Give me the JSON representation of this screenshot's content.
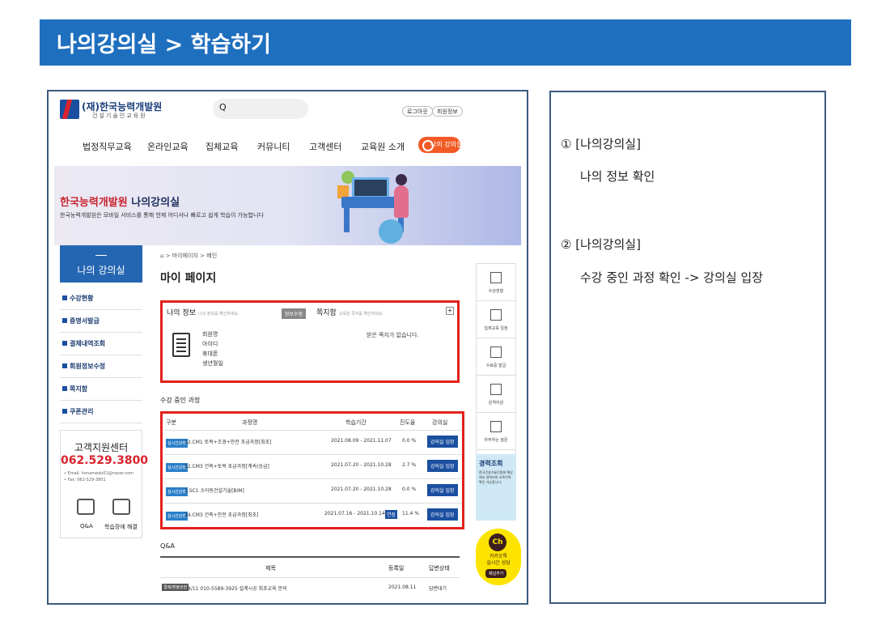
{
  "slide_title": "나의강의실 > 학습하기",
  "site": {
    "logo_text": "(재)한국능력개발원",
    "logo_sub": "건설기술인교육원",
    "search_icon": "Q",
    "header_links": [
      "로그아웃",
      "회원정보"
    ],
    "menu": [
      "법정직무교육",
      "온라인교육",
      "집체교육",
      "커뮤니티",
      "고객센터",
      "교육원 소개"
    ],
    "myroom_button": "나의 강의실"
  },
  "hero": {
    "title_red": "한국능력개발원",
    "title_dark": "나의강의실",
    "subtitle": "한국능력개발원은 모바일 서비스를 통해 언제 어디서나 빠르고 쉽게 학습이 가능합니다"
  },
  "sidebar": {
    "title": "나의 강의실",
    "items": [
      "수강현황",
      "증명서발급",
      "결제내역조회",
      "회원정보수정",
      "쪽지함",
      "쿠폰관리"
    ]
  },
  "support": {
    "title": "고객지원센터",
    "phone": "062.529.3800",
    "email": "• Email: honamedu01@naver.com",
    "fax": "• Fax: 062-529-3801",
    "qa_label": "Q&A",
    "remote_label": "학습장애 해결"
  },
  "breadcrumb": "⌂ > 마이페이지 > 메인",
  "page_title": "마이 페이지",
  "my_info": {
    "header": "나의 정보",
    "header_hint": "나의 정보를 확인하세요.",
    "edit_button": "정보수정",
    "rows": [
      "회원명",
      "아이디",
      "휴대폰",
      "생년월일"
    ]
  },
  "messages": {
    "header": "쪽지함",
    "header_hint": "교육원 쪽지를 확인하세요.",
    "plus": "+",
    "empty": "받은 쪽지가 없습니다."
  },
  "courses": {
    "section_title": "수강 중인 과정",
    "headers": [
      "구분",
      "과정명",
      "학습기간",
      "진도율",
      "강의실"
    ],
    "rows": [
      {
        "badge": "실시간강좌",
        "name": "12.CM1 토목+조경+안전 초급과정[최초]",
        "period": "2021.08.09 - 2021.11.07",
        "progress": "0.0 %",
        "button": "강의실 입장",
        "extend": ""
      },
      {
        "badge": "실시간강좌",
        "name": "52.CM3 건축+토목 초급과정[계속(승급]",
        "period": "2021.07.20 - 2021.10.28",
        "progress": "2.7 %",
        "button": "강의실 입장",
        "extend": ""
      },
      {
        "badge": "실시간강좌",
        "name": "1.SC1 소아동건설기술[BIM]",
        "period": "2021.07.20 - 2021.10.28",
        "progress": "0.0 %",
        "button": "강의실 입장",
        "extend": ""
      },
      {
        "badge": "실시간강좌",
        "name": "24.CM3 건축+안전 초급과정[최초]",
        "period": "2021.07.16 - 2021.10.14",
        "progress": "11.4 %",
        "button": "강의실 입장",
        "extend": "연장"
      }
    ]
  },
  "qa": {
    "title": "Q&A",
    "headers": [
      "제목",
      "등록일",
      "답변상태"
    ],
    "row": {
      "category": "결제/환불관련",
      "subject": "8/11 010-5589-3925 설계시공 최초교육 문의",
      "date": "2021.08.11",
      "status": "답변대기"
    }
  },
  "quick_menu": [
    "수강현황",
    "집체교육 일정",
    "수료증 발급",
    "원격지원",
    "자주하는 질문"
  ],
  "promo": {
    "title": "경력조회",
    "text": "한국건설기술인협회 해당에서 경력조회 교육이력 확인 가능합니다."
  },
  "kakao": {
    "ch": "Ch",
    "line1": "카카오톡",
    "line2": "실시간 상담",
    "button": "채널추가"
  },
  "notes": [
    {
      "title": "① [나의강의실]",
      "detail": "나의 정보 확인"
    },
    {
      "title": "② [나의강의실]",
      "detail": "수강 중인 과정 확인 -> 강의실 입장"
    }
  ]
}
